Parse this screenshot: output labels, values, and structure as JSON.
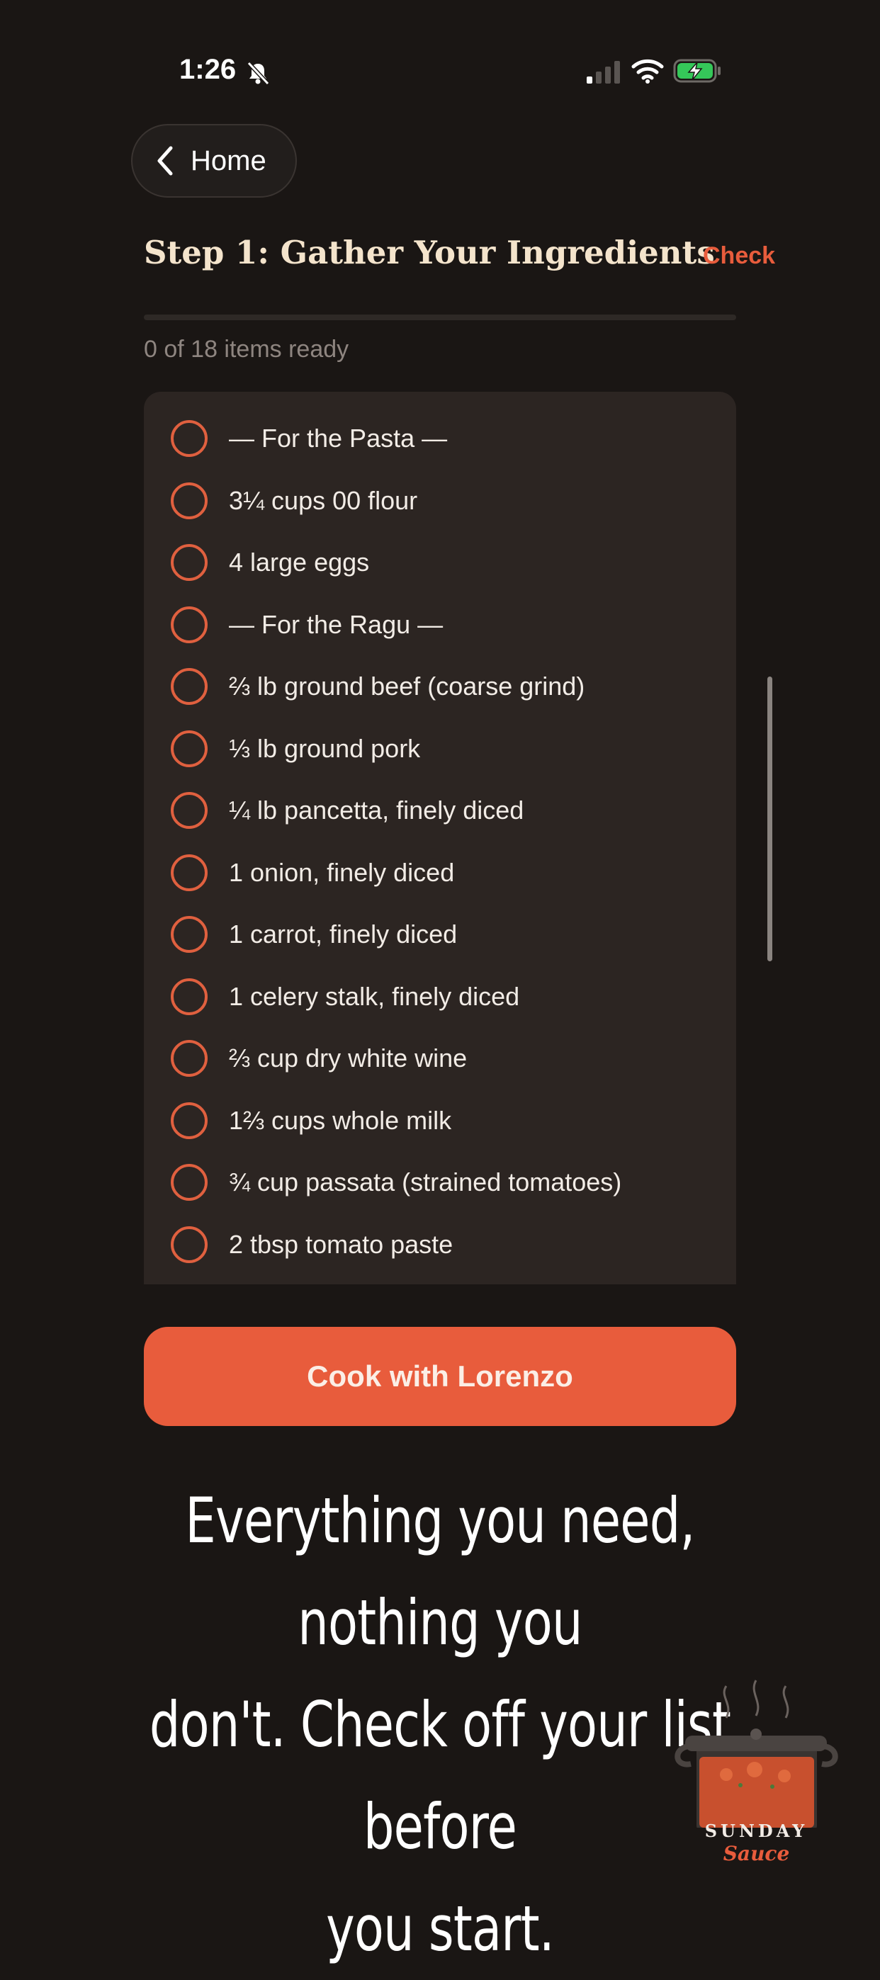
{
  "status_bar": {
    "time": "1:26"
  },
  "nav": {
    "back_label": "Home"
  },
  "header": {
    "title": "Step 1: Gather Your Ingredients",
    "check_label": "Check",
    "progress_fraction": 0,
    "progress_text": "0 of 18 items ready"
  },
  "ingredients": [
    "— For the Pasta —",
    "3¼ cups 00 flour",
    "4 large eggs",
    "— For the Ragu —",
    "⅔ lb ground beef (coarse grind)",
    "⅓ lb ground pork",
    "¼ lb pancetta, finely diced",
    "1 onion, finely diced",
    "1 carrot, finely diced",
    "1 celery stalk, finely diced",
    "⅔ cup dry white wine",
    "1⅔ cups whole milk",
    "¾ cup passata (strained tomatoes)",
    "2 tbsp tomato paste"
  ],
  "cta": {
    "label": "Cook with Lorenzo"
  },
  "tagline": {
    "line1": "Everything you need, nothing you",
    "line2": "don't. Check off your list before",
    "line3": "you start."
  },
  "logo": {
    "word1": "SUNDAY",
    "word2": "Sauce"
  },
  "colors": {
    "accent": "#e85c3c",
    "background": "#1a1614",
    "card": "#2c2522",
    "title": "#f4e4cc"
  },
  "icons": [
    "bell-slash-icon",
    "signal-icon",
    "wifi-icon",
    "battery-charging-icon",
    "chevron-left-icon",
    "pot-icon"
  ]
}
